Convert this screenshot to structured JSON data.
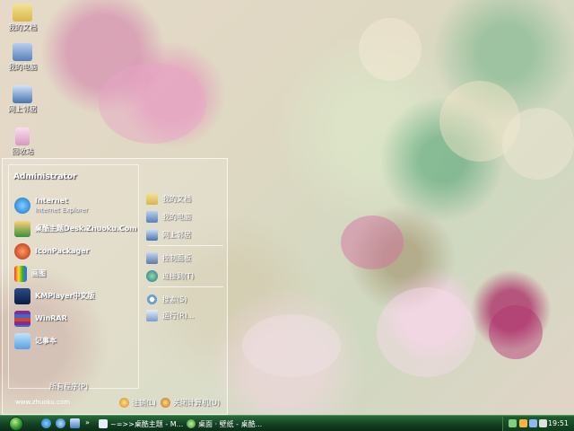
{
  "desktop": {
    "icons": [
      {
        "label": "我的文档",
        "icon": "my-documents-icon"
      },
      {
        "label": "我的电脑",
        "icon": "my-computer-icon"
      },
      {
        "label": "网上邻居",
        "icon": "network-places-icon"
      },
      {
        "label": "回收站",
        "icon": "recycle-bin-icon"
      }
    ]
  },
  "start_menu": {
    "user": "Administrator",
    "pinned": [
      {
        "title": "Internet",
        "subtitle": "Internet Explorer",
        "icon": "internet-explorer-icon"
      },
      {
        "title": "桌酷主题Desk.Zhuoku.Com",
        "subtitle": "",
        "icon": "theme-icon"
      },
      {
        "title": "IconPackager",
        "subtitle": "",
        "icon": "iconpackager-icon"
      },
      {
        "title": "画图",
        "subtitle": "",
        "icon": "paint-icon"
      },
      {
        "title": "KMPlayer中文版",
        "subtitle": "",
        "icon": "kmplayer-icon"
      },
      {
        "title": "WinRAR",
        "subtitle": "",
        "icon": "winrar-icon"
      },
      {
        "title": "记事本",
        "subtitle": "",
        "icon": "notepad-icon"
      }
    ],
    "all_programs": "所有程序(P)",
    "right_items": [
      {
        "label": "我的文档",
        "icon": "my-documents-icon"
      },
      {
        "label": "我的电脑",
        "icon": "my-computer-icon"
      },
      {
        "label": "网上邻居",
        "icon": "network-places-icon"
      },
      {
        "label": "控制面板",
        "icon": "control-panel-icon"
      },
      {
        "label": "连接到(T)",
        "icon": "connect-to-icon"
      },
      {
        "label": "搜索(S)",
        "icon": "search-icon"
      },
      {
        "label": "运行(R)...",
        "icon": "run-icon"
      }
    ],
    "footer": {
      "url": "www.zhuoku.com",
      "logoff": "注销(L)",
      "shutdown": "关闭计算机(U)"
    }
  },
  "taskbar": {
    "arrow": "»",
    "tasks": [
      {
        "label": "~=>>桌酷主题 - M...",
        "icon": "document-icon"
      },
      {
        "label": "桌面 · 壁纸 - 桌酷...",
        "icon": "browser-icon"
      }
    ],
    "clock": "19:51"
  },
  "colors": {
    "taskbar": "#1a5a2a",
    "start_orb": "#2e8b2e",
    "menu_border": "#ffffff"
  }
}
